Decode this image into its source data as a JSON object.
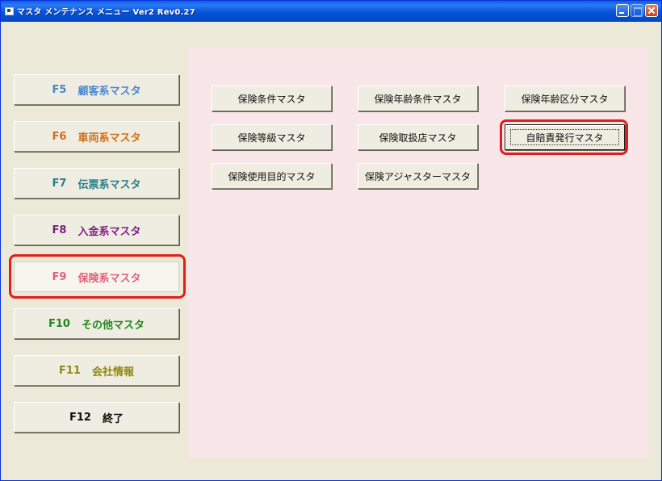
{
  "window": {
    "title": "マスタ メンテナンス メニュー Ver2 Rev0.27"
  },
  "menu": [
    {
      "key": "F5",
      "label": "顧客系マスタ",
      "color": "#4a88cf"
    },
    {
      "key": "F6",
      "label": "車両系マスタ",
      "color": "#d0701a"
    },
    {
      "key": "F7",
      "label": "伝票系マスタ",
      "color": "#2a7f88"
    },
    {
      "key": "F8",
      "label": "入金系マスタ",
      "color": "#7e1f84"
    },
    {
      "key": "F9",
      "label": "保険系マスタ",
      "color": "#e0617a",
      "active": true
    },
    {
      "key": "F10",
      "label": "その他マスタ",
      "color": "#1e8a1e"
    },
    {
      "key": "F11",
      "label": "会社情報",
      "color": "#8f8a12"
    },
    {
      "key": "F12",
      "label": "終了",
      "color": "#111111"
    }
  ],
  "submenu": [
    {
      "label": "保険条件マスタ"
    },
    {
      "label": "保険年齢条件マスタ"
    },
    {
      "label": "保険年齢区分マスタ"
    },
    {
      "label": "保険等級マスタ"
    },
    {
      "label": "保険取扱店マスタ"
    },
    {
      "label": "自賠責発行マスタ",
      "focused": true
    },
    {
      "label": "保険使用目的マスタ"
    },
    {
      "label": "保険アジャスターマスタ"
    }
  ],
  "colors": {
    "panel_bg": "#f8e6e9",
    "window_bg": "#ece9d8",
    "highlight_ring": "#e21c1c"
  }
}
